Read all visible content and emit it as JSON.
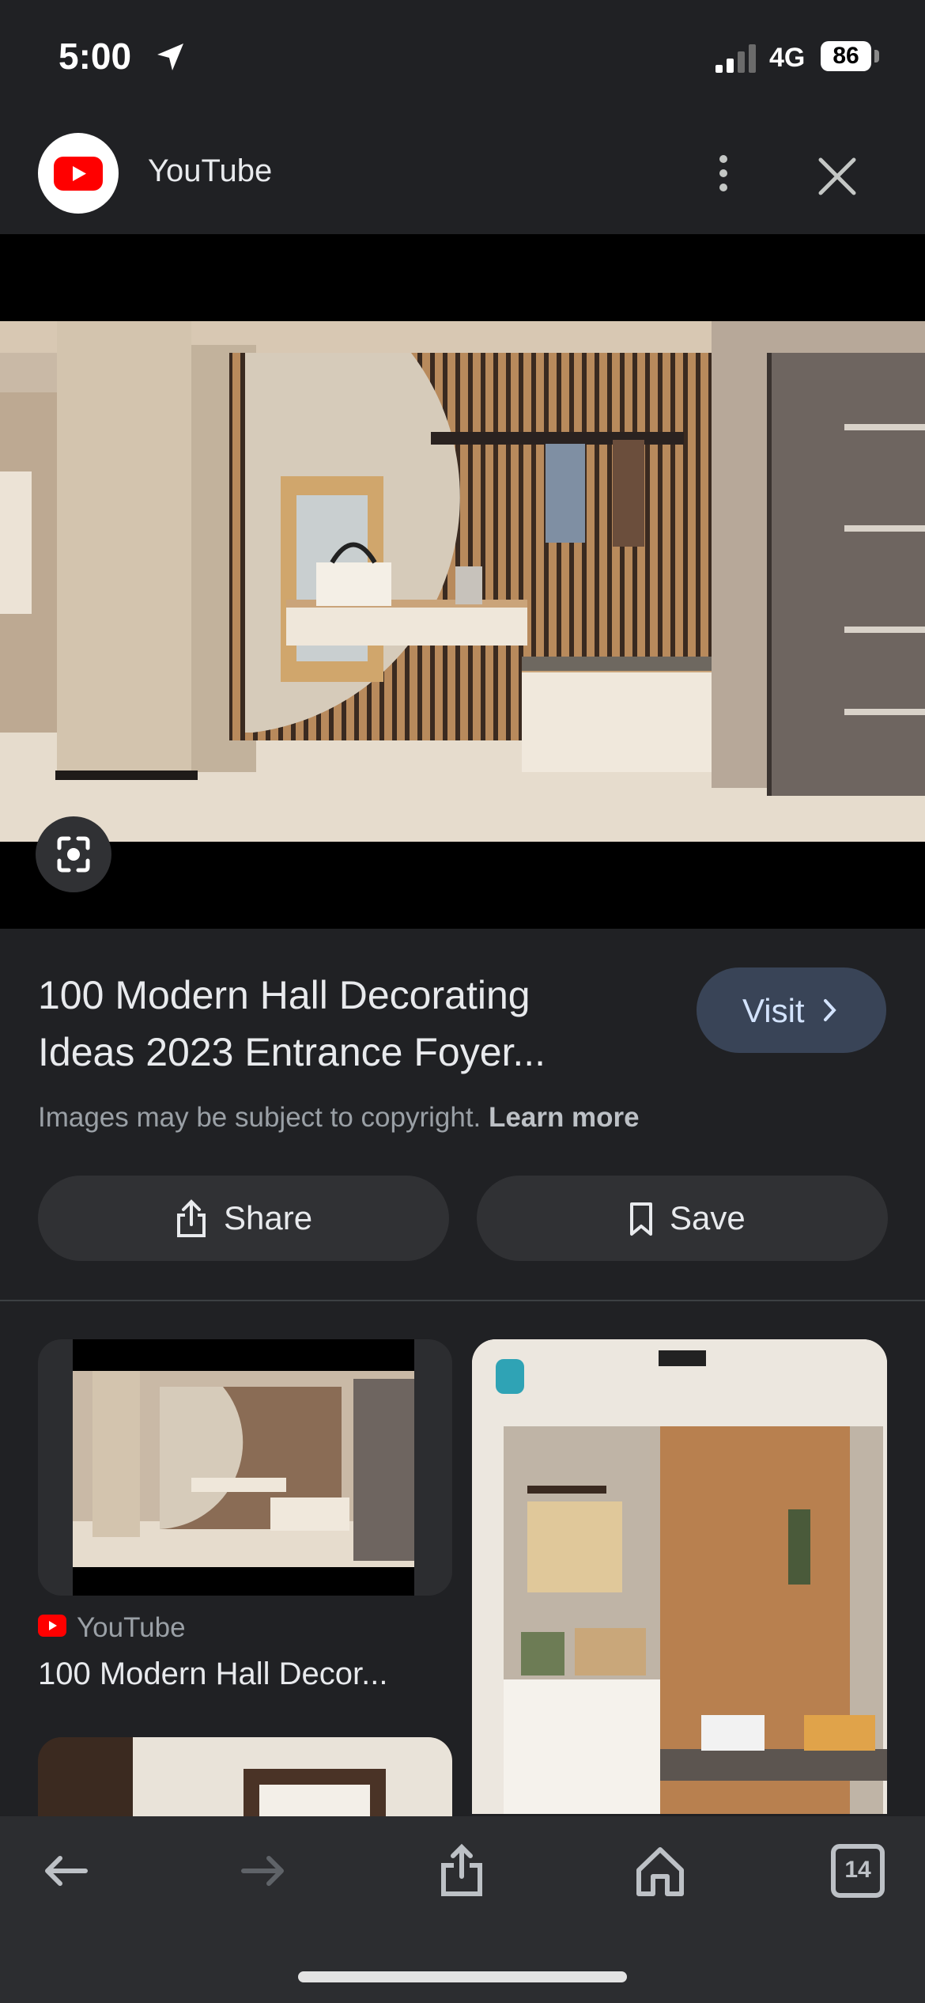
{
  "status_bar": {
    "time": "5:00",
    "network": "4G",
    "battery": "86"
  },
  "header": {
    "source_name": "YouTube"
  },
  "result": {
    "title_line1": "100 Modern Hall Decorating",
    "title_line2": "Ideas 2023 Entrance Foyer...",
    "visit_label": "Visit",
    "copyright_text": "Images may be subject to copyright.",
    "learn_more": "Learn more",
    "share_label": "Share",
    "save_label": "Save"
  },
  "related": [
    {
      "source": "YouTube",
      "title": "100 Modern Hall Decor..."
    },
    {
      "source": "",
      "title": ""
    },
    {
      "source": "",
      "title": ""
    }
  ],
  "toolbar": {
    "tabs_count": "14"
  },
  "colors": {
    "youtube_red": "#ff0000",
    "visit_button_bg": "#394457",
    "background": "#202124",
    "pill_bg": "#303134"
  }
}
